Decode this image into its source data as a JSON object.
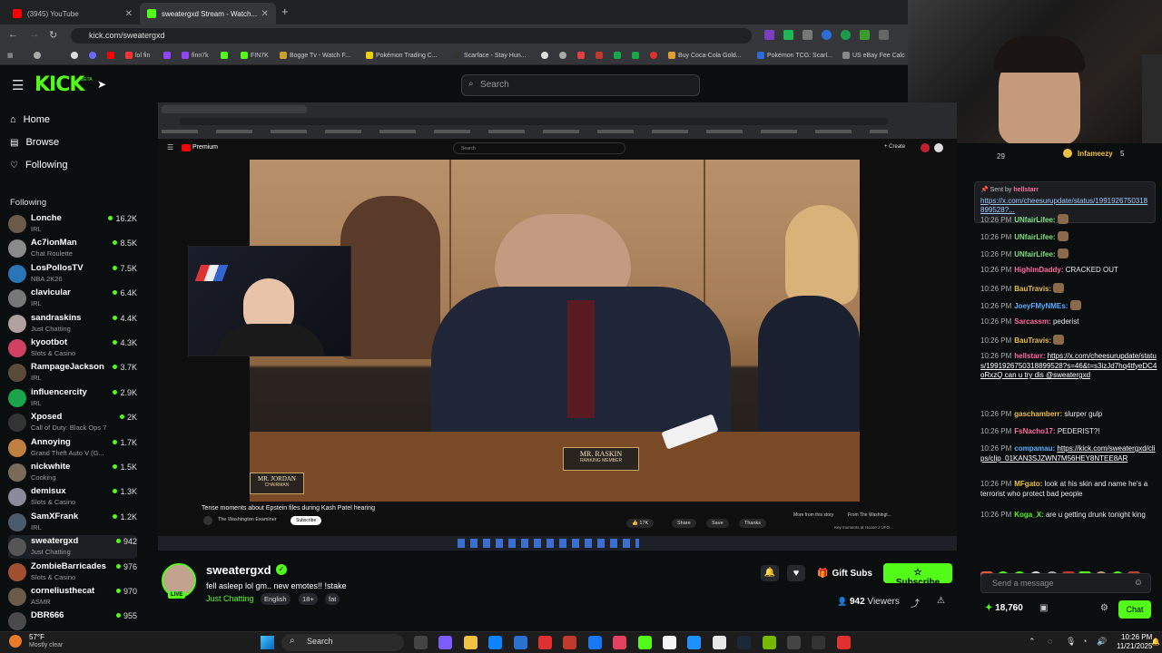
{
  "browser": {
    "tabs": [
      {
        "title": "(3945) YouTube",
        "active": false
      },
      {
        "title": "sweatergxd Stream - Watch...",
        "active": true
      }
    ],
    "new_tab": "+",
    "url": "kick.com/sweatergxd",
    "bookmarks": [
      "lol fin",
      "finn7k",
      "FIN7K",
      "Bogge Tv - Watch F...",
      "Pokémon Trading C...",
      "Scarface - Stay Hun...",
      "Buy Coca-Cola Gold...",
      "Pokémon TCG: Scarl...",
      "US eBay Fee Calc"
    ]
  },
  "kick": {
    "logo": "KICK",
    "logo_badge": "BETA",
    "search_placeholder": "Search",
    "nav": [
      {
        "label": "Home",
        "icon": "home-icon"
      },
      {
        "label": "Browse",
        "icon": "browse-icon"
      },
      {
        "label": "Following",
        "icon": "heart-icon"
      }
    ],
    "following_header": "Following",
    "following": [
      {
        "name": "Lonche",
        "category": "IRL",
        "viewers": "16.2K",
        "color": "#6b5a4a"
      },
      {
        "name": "Ac7ionMan",
        "category": "Chat Roulette",
        "viewers": "8.5K",
        "color": "#8a8a8a"
      },
      {
        "name": "LosPollosTV",
        "category": "NBA 2K26",
        "viewers": "7.5K",
        "color": "#2a74b8"
      },
      {
        "name": "clavicular",
        "category": "IRL",
        "viewers": "6.4K",
        "color": "#777"
      },
      {
        "name": "sandraskins",
        "category": "Just Chatting",
        "viewers": "4.4K",
        "color": "#b0a0a0"
      },
      {
        "name": "kyootbot",
        "category": "Slots & Casino",
        "viewers": "4.3K",
        "color": "#d04060"
      },
      {
        "name": "RampageJackson",
        "category": "IRL",
        "viewers": "3.7K",
        "color": "#5a4a3a"
      },
      {
        "name": "influencercity",
        "category": "IRL",
        "viewers": "2.9K",
        "color": "#1aa54a"
      },
      {
        "name": "Xposed",
        "category": "Call of Duty: Black Ops 7",
        "viewers": "2K",
        "color": "#333"
      },
      {
        "name": "Annoying",
        "category": "Grand Theft Auto V (G...",
        "viewers": "1.7K",
        "color": "#c08040"
      },
      {
        "name": "nickwhite",
        "category": "Cooking",
        "viewers": "1.5K",
        "color": "#7a6a5a"
      },
      {
        "name": "demisux",
        "category": "Slots & Casino",
        "viewers": "1.3K",
        "color": "#8a8a9a"
      },
      {
        "name": "SamXFrank",
        "category": "IRL",
        "viewers": "1.2K",
        "color": "#4a5a6a"
      },
      {
        "name": "sweatergxd",
        "category": "Just Chatting",
        "viewers": "942",
        "color": "#555",
        "active": true
      },
      {
        "name": "ZombieBarricades",
        "category": "Slots & Casino",
        "viewers": "976",
        "color": "#a05030"
      },
      {
        "name": "corneliusthecat",
        "category": "ASMR",
        "viewers": "970",
        "color": "#6a5a4a"
      },
      {
        "name": "DBR666",
        "category": "",
        "viewers": "955",
        "color": "#4a4a4a"
      }
    ]
  },
  "video_screen": {
    "youtube_label": "Premium",
    "youtube_search": "Search",
    "create": "+ Create",
    "video_title": "Tense moments about Epstein files during Kash Patel hearing",
    "channel": "The Washington Examiner",
    "subscribe": "Subscribe",
    "nameplate_1": "MR. RASKIN",
    "nameplate_1_sub": "RANKING MEMBER",
    "nameplate_2": "MR. JORDAN",
    "nameplate_2_sub": "CHAIRMAN",
    "likes": "17K",
    "actions": [
      "Share",
      "Save",
      "Thanks"
    ],
    "more": "More from this story",
    "from_the": "From The Washingt...",
    "related": "Key moments at House J UFO..."
  },
  "stream": {
    "streamer": "sweatergxd",
    "live": "LIVE",
    "title": "fell asleep lol gm.. new emotes!! !stake",
    "category": "Just Chatting",
    "tags": [
      "English",
      "18+",
      "fat"
    ],
    "viewers": "942",
    "viewers_label": "Viewers",
    "gift_subs": "Gift Subs",
    "subscribe": "Subscribe"
  },
  "chat": {
    "top_user": "Infameezy",
    "top_count": "5",
    "top_count_left": "29",
    "pinned_by": "Sent by",
    "pinned_user": "hellstarr",
    "pinned_link": "https://x.com/cheesurupdate/status/1991926750318899528?...",
    "messages": [
      {
        "time": "10:26 PM",
        "user": "UNfairLifee:",
        "text": "",
        "color": "#7fe07f"
      },
      {
        "time": "10:26 PM",
        "user": "UNfairLifee:",
        "text": "",
        "color": "#7fe07f"
      },
      {
        "time": "10:26 PM",
        "user": "UNfairLifee:",
        "text": "",
        "color": "#7fe07f"
      },
      {
        "time": "10:26 PM",
        "user": "HighlmDaddy:",
        "text": "CRACKED OUT",
        "color": "#ff6b9e"
      },
      {
        "time": "10:26 PM",
        "user": "BauTravis:",
        "text": "",
        "color": "#f0c040"
      },
      {
        "time": "10:26 PM",
        "user": "JoeyFMyNMEs:",
        "text": "",
        "color": "#5bb0ff"
      },
      {
        "time": "10:26 PM",
        "user": "Sarcassm:",
        "text": "pederist",
        "color": "#ff6b9e"
      },
      {
        "time": "10:26 PM",
        "user": "BauTravis:",
        "text": "",
        "color": "#f0c040"
      },
      {
        "time": "10:26 PM",
        "user": "hellstarr:",
        "text": "https://x.com/cheesurupdate/status/1991926750318899528?s=46&t=s3izJd7hq4tfyeDC4oRxzQ can u try dis @sweatergxd",
        "color": "#ff6b9e"
      },
      {
        "time": "10:26 PM",
        "user": "gaschamberr:",
        "text": "slurper gulp",
        "color": "#f0c040"
      },
      {
        "time": "10:26 PM",
        "user": "FsNacho17:",
        "text": "PEDERIST?!",
        "color": "#ff6b9e"
      },
      {
        "time": "10:26 PM",
        "user": "compamau:",
        "text": "https://kick.com/sweatergxd/clips/clip_01KAN3SJZWN7M56HEY8NTEE8AR",
        "color": "#5bb0ff"
      },
      {
        "time": "10:26 PM",
        "user": "MFgato:",
        "text": "look at his skin and name he's a terrorist who protect bad people",
        "color": "#f0c040"
      },
      {
        "time": "10:26 PM",
        "user": "Koga_X:",
        "text": "are u getting drunk tonight king",
        "color": "#53fc18"
      }
    ],
    "input_placeholder": "Send a message",
    "points": "18,760",
    "chat_button": "Chat"
  },
  "taskbar": {
    "weather_temp": "57°F",
    "weather_desc": "Mostly clear",
    "search": "Search",
    "time": "10:26 PM",
    "date": "11/21/2025"
  },
  "colors": {
    "kick_green": "#53fc18",
    "bg": "#0b0e0f"
  }
}
